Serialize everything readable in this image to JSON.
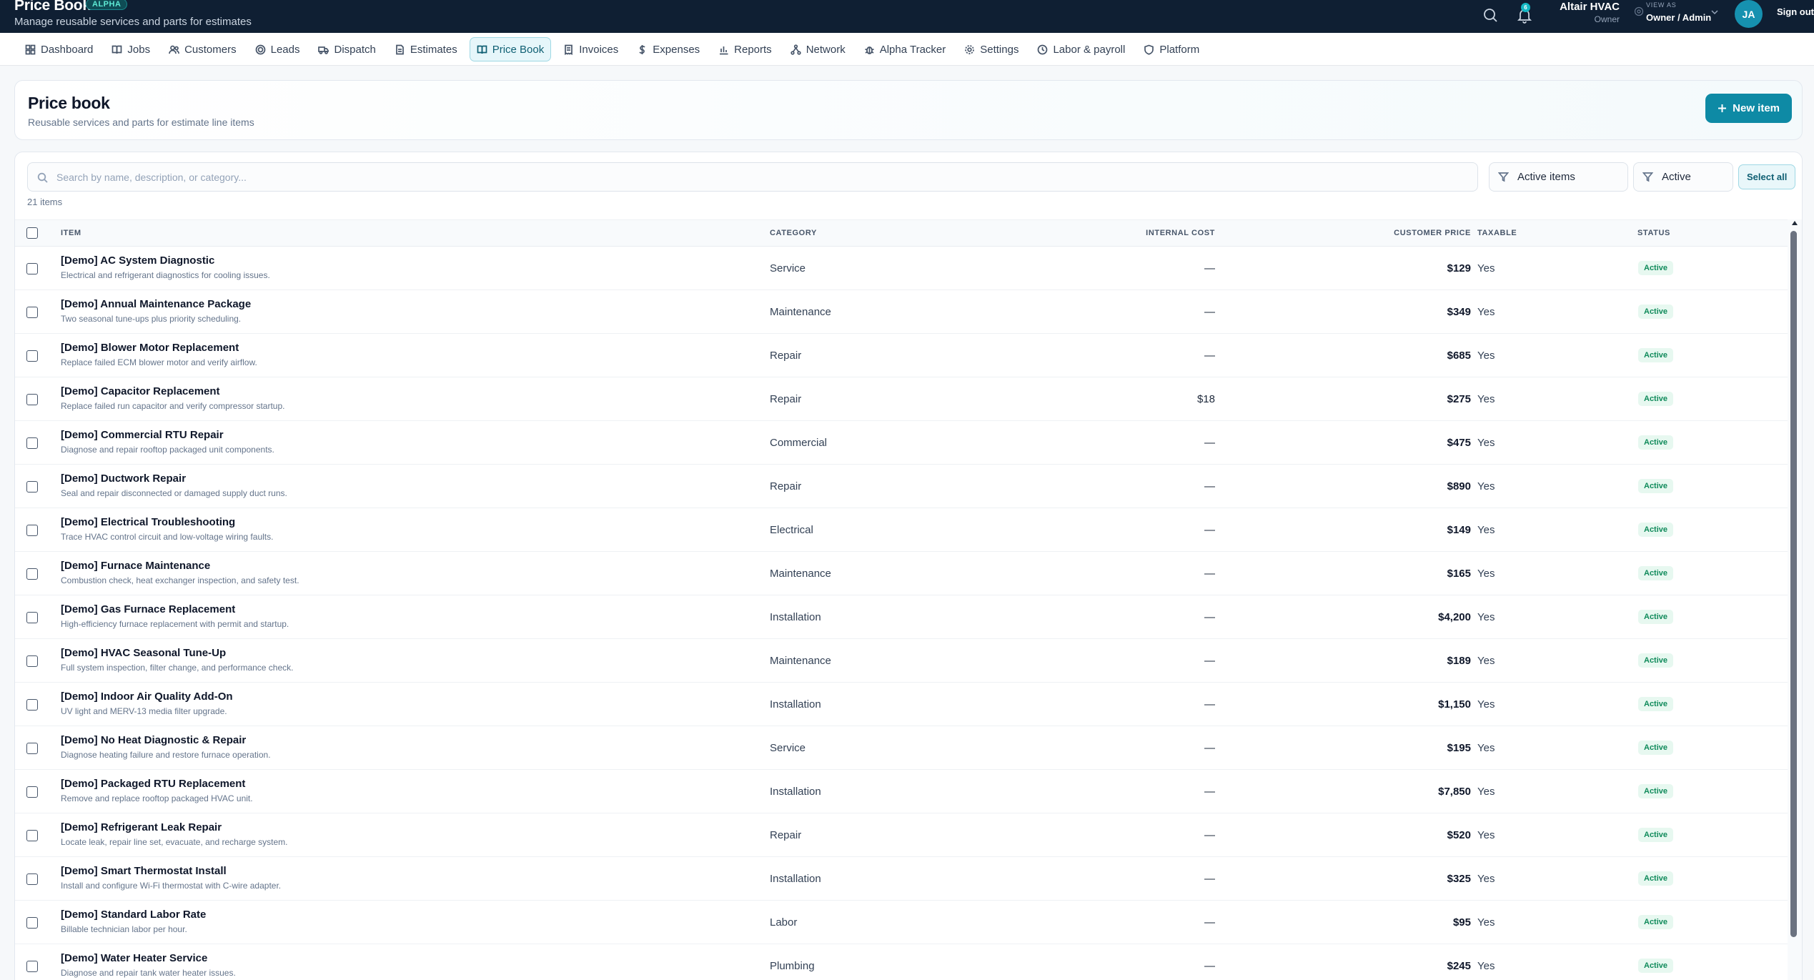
{
  "header": {
    "title": "Price Book",
    "badge": "ALPHA",
    "subtitle": "Manage reusable services and parts for estimates",
    "notification_count": "6",
    "org_name": "Altair HVAC",
    "org_role": "Owner",
    "view_as_label": "VIEW AS",
    "view_as_value": "Owner / Admin",
    "avatar_initials": "JA",
    "signout_label": "Sign out"
  },
  "nav": {
    "items": [
      {
        "label": "Dashboard",
        "icon": "dashboard-icon"
      },
      {
        "label": "Jobs",
        "icon": "book-icon"
      },
      {
        "label": "Customers",
        "icon": "users-icon"
      },
      {
        "label": "Leads",
        "icon": "target-icon"
      },
      {
        "label": "Dispatch",
        "icon": "truck-icon"
      },
      {
        "label": "Estimates",
        "icon": "document-icon"
      },
      {
        "label": "Price Book",
        "icon": "book-open-icon",
        "active": true
      },
      {
        "label": "Invoices",
        "icon": "receipt-icon"
      },
      {
        "label": "Expenses",
        "icon": "dollar-icon"
      },
      {
        "label": "Reports",
        "icon": "bar-chart-icon"
      },
      {
        "label": "Network",
        "icon": "network-icon"
      },
      {
        "label": "Alpha Tracker",
        "icon": "bug-icon"
      },
      {
        "label": "Settings",
        "icon": "gear-icon"
      },
      {
        "label": "Labor & payroll",
        "icon": "clock-icon"
      },
      {
        "label": "Platform",
        "icon": "shield-icon"
      }
    ]
  },
  "page": {
    "title": "Price book",
    "subtitle": "Reusable services and parts for estimate line items",
    "new_item_label": "New item"
  },
  "toolbar": {
    "search_placeholder": "Search by name, description, or category...",
    "filter_scope": "Active items",
    "filter_status": "Active",
    "select_all_label": "Select all",
    "item_count": "21 items"
  },
  "table": {
    "headers": {
      "item": "ITEM",
      "category": "CATEGORY",
      "internal_cost": "INTERNAL COST",
      "customer_price": "CUSTOMER PRICE",
      "taxable": "TAXABLE",
      "status": "STATUS"
    },
    "rows": [
      {
        "name": "[Demo] AC System Diagnostic",
        "desc": "Electrical and refrigerant diagnostics for cooling issues.",
        "category": "Service",
        "cost": "—",
        "price": "$129",
        "taxable": "Yes",
        "status": "Active"
      },
      {
        "name": "[Demo] Annual Maintenance Package",
        "desc": "Two seasonal tune-ups plus priority scheduling.",
        "category": "Maintenance",
        "cost": "—",
        "price": "$349",
        "taxable": "Yes",
        "status": "Active"
      },
      {
        "name": "[Demo] Blower Motor Replacement",
        "desc": "Replace failed ECM blower motor and verify airflow.",
        "category": "Repair",
        "cost": "—",
        "price": "$685",
        "taxable": "Yes",
        "status": "Active"
      },
      {
        "name": "[Demo] Capacitor Replacement",
        "desc": "Replace failed run capacitor and verify compressor startup.",
        "category": "Repair",
        "cost": "$18",
        "price": "$275",
        "taxable": "Yes",
        "status": "Active"
      },
      {
        "name": "[Demo] Commercial RTU Repair",
        "desc": "Diagnose and repair rooftop packaged unit components.",
        "category": "Commercial",
        "cost": "—",
        "price": "$475",
        "taxable": "Yes",
        "status": "Active"
      },
      {
        "name": "[Demo] Ductwork Repair",
        "desc": "Seal and repair disconnected or damaged supply duct runs.",
        "category": "Repair",
        "cost": "—",
        "price": "$890",
        "taxable": "Yes",
        "status": "Active"
      },
      {
        "name": "[Demo] Electrical Troubleshooting",
        "desc": "Trace HVAC control circuit and low-voltage wiring faults.",
        "category": "Electrical",
        "cost": "—",
        "price": "$149",
        "taxable": "Yes",
        "status": "Active"
      },
      {
        "name": "[Demo] Furnace Maintenance",
        "desc": "Combustion check, heat exchanger inspection, and safety test.",
        "category": "Maintenance",
        "cost": "—",
        "price": "$165",
        "taxable": "Yes",
        "status": "Active"
      },
      {
        "name": "[Demo] Gas Furnace Replacement",
        "desc": "High-efficiency furnace replacement with permit and startup.",
        "category": "Installation",
        "cost": "—",
        "price": "$4,200",
        "taxable": "Yes",
        "status": "Active"
      },
      {
        "name": "[Demo] HVAC Seasonal Tune-Up",
        "desc": "Full system inspection, filter change, and performance check.",
        "category": "Maintenance",
        "cost": "—",
        "price": "$189",
        "taxable": "Yes",
        "status": "Active"
      },
      {
        "name": "[Demo] Indoor Air Quality Add-On",
        "desc": "UV light and MERV-13 media filter upgrade.",
        "category": "Installation",
        "cost": "—",
        "price": "$1,150",
        "taxable": "Yes",
        "status": "Active"
      },
      {
        "name": "[Demo] No Heat Diagnostic & Repair",
        "desc": "Diagnose heating failure and restore furnace operation.",
        "category": "Service",
        "cost": "—",
        "price": "$195",
        "taxable": "Yes",
        "status": "Active"
      },
      {
        "name": "[Demo] Packaged RTU Replacement",
        "desc": "Remove and replace rooftop packaged HVAC unit.",
        "category": "Installation",
        "cost": "—",
        "price": "$7,850",
        "taxable": "Yes",
        "status": "Active"
      },
      {
        "name": "[Demo] Refrigerant Leak Repair",
        "desc": "Locate leak, repair line set, evacuate, and recharge system.",
        "category": "Repair",
        "cost": "—",
        "price": "$520",
        "taxable": "Yes",
        "status": "Active"
      },
      {
        "name": "[Demo] Smart Thermostat Install",
        "desc": "Install and configure Wi-Fi thermostat with C-wire adapter.",
        "category": "Installation",
        "cost": "—",
        "price": "$325",
        "taxable": "Yes",
        "status": "Active"
      },
      {
        "name": "[Demo] Standard Labor Rate",
        "desc": "Billable technician labor per hour.",
        "category": "Labor",
        "cost": "—",
        "price": "$95",
        "taxable": "Yes",
        "status": "Active"
      },
      {
        "name": "[Demo] Water Heater Service",
        "desc": "Diagnose and repair tank water heater issues.",
        "category": "Plumbing",
        "cost": "—",
        "price": "$245",
        "taxable": "Yes",
        "status": "Active"
      }
    ]
  },
  "colors": {
    "header_bg": "#0f1f33",
    "accent": "#0e8aa5",
    "status_active": "#0f8a5a"
  }
}
